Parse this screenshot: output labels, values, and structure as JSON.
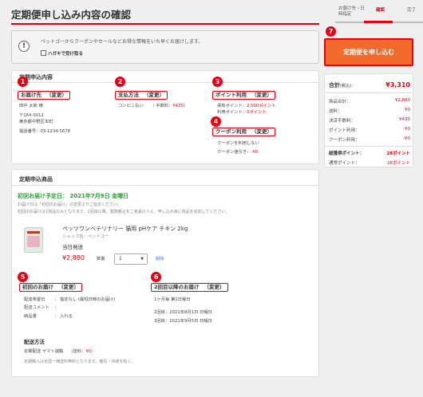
{
  "page_title": "定期便申し込み内容の確認",
  "steps": {
    "step1": "お届け先・日時指定",
    "step2": "確認",
    "step3": "完了"
  },
  "info": {
    "icon": "info-icon",
    "text": "ペットゴーからクーポンやセールなどお得な情報をいち早くお届けします。",
    "checkbox_label": "ハガキで受け取る"
  },
  "contents_section": {
    "heading": "定期申込内容"
  },
  "badges": [
    "1",
    "2",
    "3",
    "4",
    "5",
    "6",
    "7"
  ],
  "delivery": {
    "label": "お届け先",
    "change": "（変更）",
    "name": "田中 太郎 様",
    "zip": "〒164-0012",
    "address": "東京都中野区本町",
    "phone": "電話番号：03-1234-5678"
  },
  "payment": {
    "label": "支払方法",
    "change": "（変更）",
    "method": "コンビニ払い",
    "fee_label": "（ 手数料：",
    "fee_value": "¥430",
    "fee_close": "）"
  },
  "points": {
    "label": "ポイント利用",
    "change": "（変更）",
    "held_label": "保有ポイント：",
    "held_value": "2,500ポイント",
    "use_label": "利用ポイント：",
    "use_value": "0ポイント"
  },
  "coupon": {
    "label": "クーポン利用",
    "change": "（変更）",
    "none": "クーポンを利用しない",
    "discount_label": "クーポン値引き：",
    "discount_value": "-¥0"
  },
  "products_section": {
    "heading": "定期申込商品",
    "first_date": "初回お届け予定日：  2021年7月9日 金曜日",
    "note1": "お届け日は「初回のお届け」の変更よりご指定ください。",
    "note2": "初回のお届けは1商品のみとなります。2回目以降、業務都合をご考慮のうえ、申し込み後に商品を追加してください。",
    "product_name": "ペッツワンベテリナリー 猫用 pHケア チキン 2kg",
    "shop": "ショップ名：ペットゴー",
    "shipping": "当日発送",
    "price": "¥2,880",
    "qty_label": "数量",
    "qty_value": "1",
    "delete": "削除"
  },
  "first_delivery": {
    "label": "初回のお届け",
    "change": "（変更）",
    "r1_label": "配達希望日",
    "r1_value": "：  指定なし (最短日時のお届け)",
    "r2_label": "配送コメント",
    "r2_value": "：",
    "r3_label": "納品書",
    "r3_value": "：  入れる"
  },
  "second_delivery": {
    "label": "2回目以降のお届け",
    "change": "（変更）",
    "cycle": "1ヶ月毎 第1日曜日",
    "d2": "2回目：2021年8月1日 日曜日",
    "d3": "3回目：2021年9月5日 日曜日"
  },
  "shipping_method": {
    "heading": "配送方法",
    "line_label": "定期配送  ヤマト運輸",
    "fee_label": "（送料：",
    "fee_value": "¥0",
    "fee_close": "）",
    "note": "定期購入は全国一律送料無料となります。離島・沖縄を除く。"
  },
  "apply_button": "定期便を申し込む",
  "summary": {
    "total_label": "合計",
    "total_tax": "(税込)：",
    "total_value": "¥3,310",
    "rows": [
      {
        "label": "商品合計：",
        "value": "¥2,880"
      },
      {
        "label": "送料：",
        "value": "¥0"
      },
      {
        "label": "決済手数料：",
        "value": "¥430"
      },
      {
        "label": "ポイント利用：",
        "value": "-¥0"
      },
      {
        "label": "クーポン利用：",
        "value": "-¥0"
      }
    ],
    "total_points_label": "総獲得ポイント：",
    "total_points_value": "28ポイント",
    "normal_points_label": "通常ポイント：",
    "normal_points_value": "28ポイント"
  },
  "colors": {
    "accent": "#e60012",
    "button": "#f36a2d",
    "green": "#2c9e3a"
  }
}
